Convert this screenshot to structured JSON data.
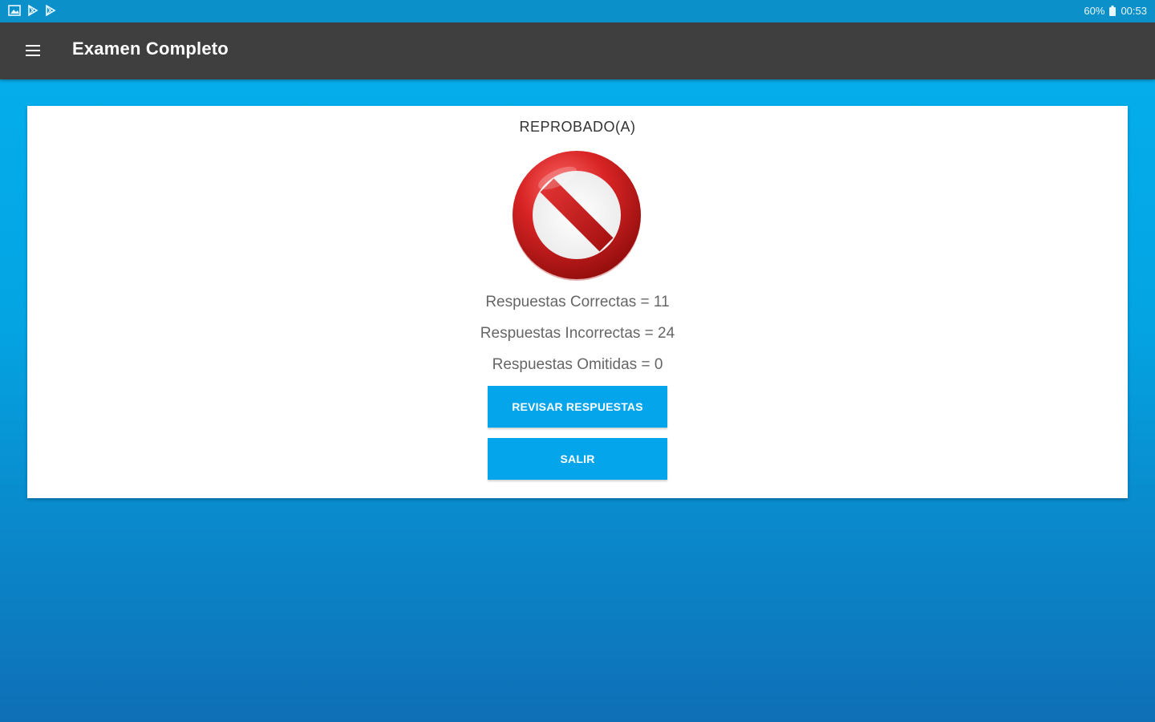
{
  "status_bar": {
    "left_icons": [
      "gallery-icon",
      "play-store-icon",
      "play-store-icon"
    ],
    "battery": "60%",
    "time": "00:53"
  },
  "app_bar": {
    "title": "Examen Completo",
    "menu_icon": "hamburger-menu-icon"
  },
  "result": {
    "title": "REPROBADO(A)",
    "icon": "prohibited-icon",
    "icon_colors": {
      "ring": "#c61a1a",
      "highlight": "#ff5a5a"
    },
    "stats": {
      "correct": "Respuestas Correctas = 11",
      "incorrect": "Respuestas Incorrectas = 24",
      "omitted": "Respuestas Omitidas = 0"
    },
    "buttons": {
      "review": "REVISAR RESPUESTAS",
      "exit": "SALIR"
    }
  },
  "colors": {
    "app_bar": "#3f3f3f",
    "accent": "#05a5ec",
    "background": "#05b0ee"
  }
}
